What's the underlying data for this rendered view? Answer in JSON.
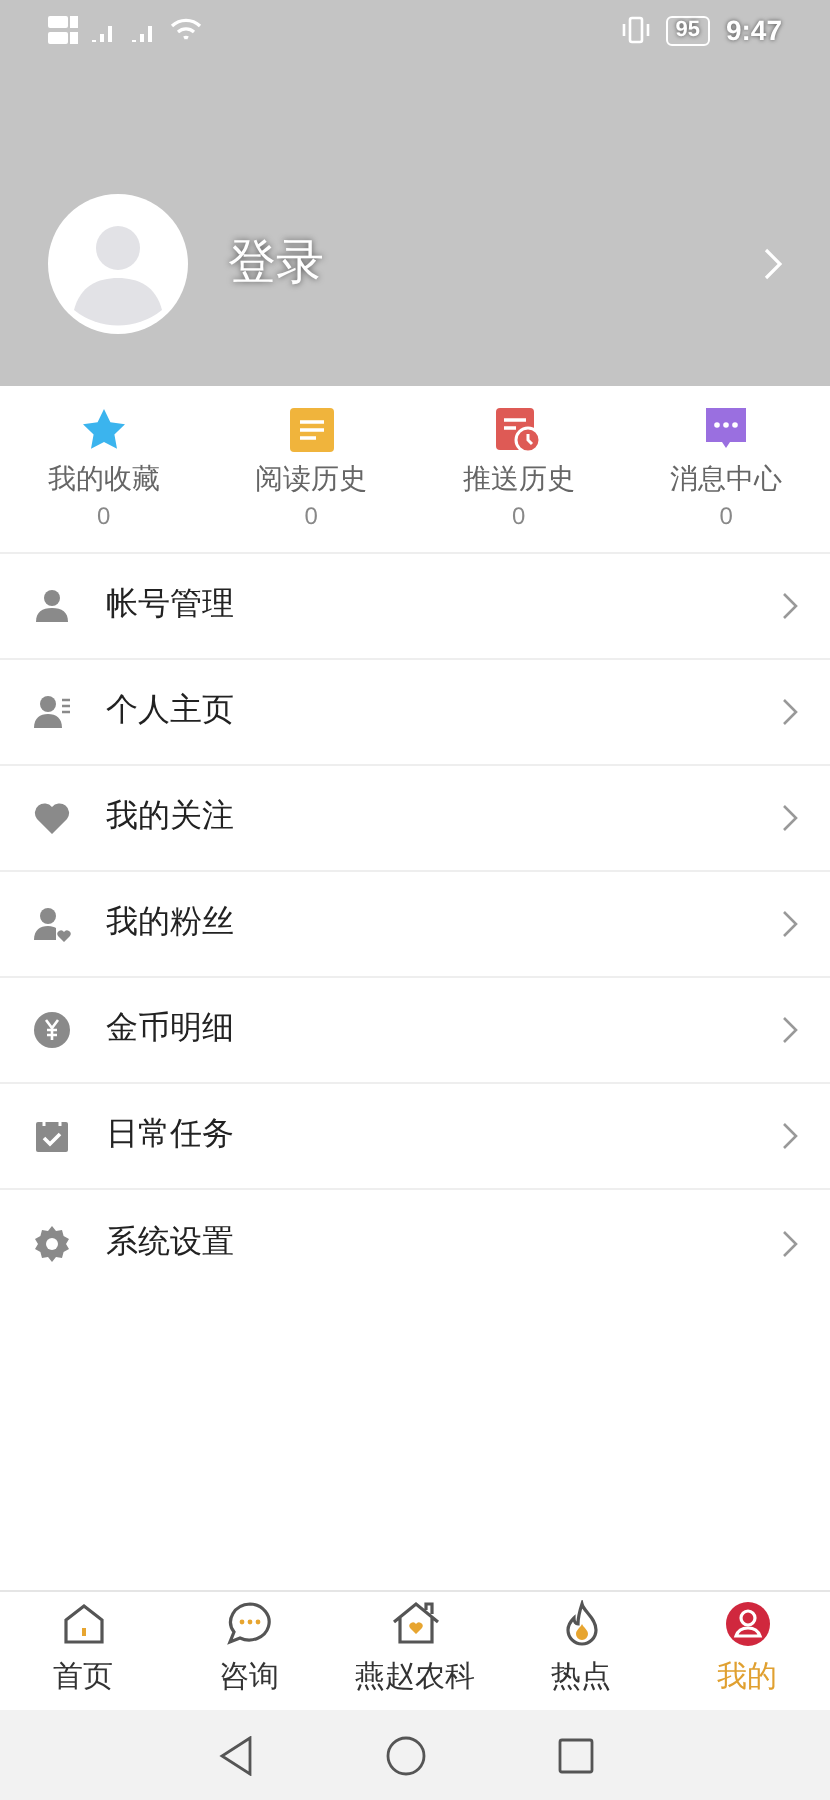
{
  "status_bar": {
    "battery": "95",
    "time": "9:47"
  },
  "profile": {
    "login": "登录"
  },
  "stats": [
    {
      "kind": "favorites",
      "label": "我的收藏",
      "count": "0"
    },
    {
      "kind": "reading",
      "label": "阅读历史",
      "count": "0"
    },
    {
      "kind": "push",
      "label": "推送历史",
      "count": "0"
    },
    {
      "kind": "messages",
      "label": "消息中心",
      "count": "0"
    }
  ],
  "menu": [
    {
      "kind": "account",
      "label": "帐号管理"
    },
    {
      "kind": "homepage",
      "label": "个人主页"
    },
    {
      "kind": "follow",
      "label": "我的关注"
    },
    {
      "kind": "fans",
      "label": "我的粉丝"
    },
    {
      "kind": "coins",
      "label": "金币明细"
    },
    {
      "kind": "tasks",
      "label": "日常任务"
    },
    {
      "kind": "settings",
      "label": "系统设置"
    }
  ],
  "tabs": [
    {
      "kind": "home",
      "label": "首页",
      "selected": false
    },
    {
      "kind": "chat",
      "label": "咨询",
      "selected": false
    },
    {
      "kind": "farm",
      "label": "燕赵农科",
      "selected": false
    },
    {
      "kind": "hot",
      "label": "热点",
      "selected": false
    },
    {
      "kind": "mine",
      "label": "我的",
      "selected": true
    }
  ]
}
